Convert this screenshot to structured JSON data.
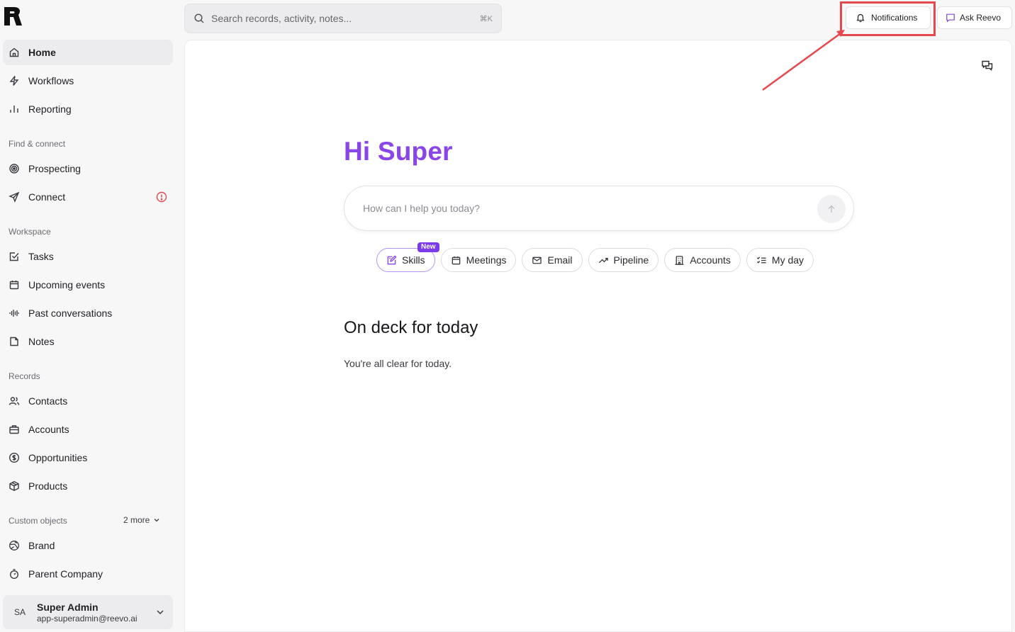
{
  "search": {
    "placeholder": "Search records, activity, notes...",
    "shortcut": "⌘K"
  },
  "topbar": {
    "notifications_label": "Notifications",
    "ask_label": "Ask Reevo"
  },
  "sidebar": {
    "primary": [
      {
        "label": "Home",
        "icon": "home-icon"
      },
      {
        "label": "Workflows",
        "icon": "lightning-icon"
      },
      {
        "label": "Reporting",
        "icon": "bar-chart-icon"
      }
    ],
    "sections": {
      "find_connect": "Find & connect",
      "workspace": "Workspace",
      "records": "Records",
      "custom_objects": "Custom objects"
    },
    "find_connect_items": [
      {
        "label": "Prospecting",
        "icon": "target-icon"
      },
      {
        "label": "Connect",
        "icon": "send-icon"
      }
    ],
    "workspace_items": [
      {
        "label": "Tasks",
        "icon": "task-check-icon"
      },
      {
        "label": "Upcoming events",
        "icon": "calendar-icon"
      },
      {
        "label": "Past conversations",
        "icon": "waveform-icon"
      },
      {
        "label": "Notes",
        "icon": "note-icon"
      }
    ],
    "records_items": [
      {
        "label": "Contacts",
        "icon": "contacts-icon"
      },
      {
        "label": "Accounts",
        "icon": "briefcase-icon"
      },
      {
        "label": "Opportunities",
        "icon": "dollar-circle-icon"
      },
      {
        "label": "Products",
        "icon": "box-icon"
      }
    ],
    "custom_more": "2 more",
    "custom_items": [
      {
        "label": "Brand",
        "icon": "globe-icon"
      },
      {
        "label": "Parent Company",
        "icon": "stopwatch-icon"
      }
    ],
    "user": {
      "initials": "SA",
      "name": "Super Admin",
      "email": "app-superadmin@reevo.ai"
    }
  },
  "main": {
    "greeting": "Hi Super",
    "prompt_placeholder": "How can I help you today?",
    "chips": [
      {
        "label": "Skills",
        "badge": "New",
        "icon": "skills-edit-icon"
      },
      {
        "label": "Meetings",
        "icon": "calendar-icon"
      },
      {
        "label": "Email",
        "icon": "mail-icon"
      },
      {
        "label": "Pipeline",
        "icon": "trend-up-icon"
      },
      {
        "label": "Accounts",
        "icon": "building-icon"
      },
      {
        "label": "My day",
        "icon": "checklist-icon"
      }
    ],
    "deck_title": "On deck for today",
    "deck_empty": "You're all clear for today."
  },
  "colors": {
    "accent": "#8a45ea",
    "badge": "#7c3aed",
    "annotation": "#e5484d"
  }
}
